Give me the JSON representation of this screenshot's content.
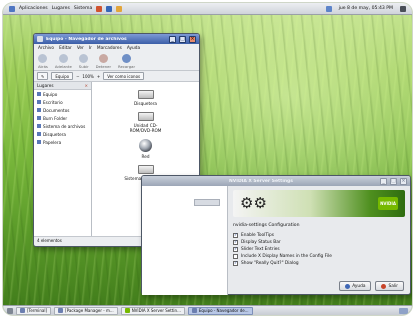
{
  "top_panel": {
    "menus": [
      "Aplicaciones",
      "Lugares",
      "Sistema"
    ],
    "clock": "jue 8 de may, 05:43 PM"
  },
  "file_manager": {
    "title": "Equipo - Navegador de archivos",
    "menu": [
      "Archivo",
      "Editar",
      "Ver",
      "Ir",
      "Marcadores",
      "Ayuda"
    ],
    "toolbar": [
      "Atrás",
      "Adelante",
      "Subir",
      "Detener",
      "Recargar"
    ],
    "location_button": "Equipo",
    "zoom": "100%",
    "view_mode": "Ver como iconos",
    "sidebar_title": "Lugares",
    "sidebar_items": [
      "Equipo",
      "Escritorio",
      "Documentos",
      "Burn Folder",
      "Sistema de archivos",
      "Disquetera",
      "Papelera"
    ],
    "devices": [
      {
        "label": "Disquetera"
      },
      {
        "label": "Unidad CD-ROM/DVD-ROM"
      },
      {
        "label": "Red"
      },
      {
        "label": "Sistema de archivos"
      }
    ],
    "status": "4 elementos"
  },
  "nvidia_window": {
    "title": "NVIDIA X Server Settings",
    "brand": "NVIDIA",
    "config_title": "nvidia-settings Configuration",
    "options": [
      {
        "label": "Enable ToolTips",
        "checked": true
      },
      {
        "label": "Display Status Bar",
        "checked": true
      },
      {
        "label": "Slider Text Entries",
        "checked": true
      },
      {
        "label": "Include X Display Names in the Config File",
        "checked": false
      },
      {
        "label": "Show \"Really Quit?\" Dialog",
        "checked": true
      }
    ],
    "help_button": "Ayuda",
    "quit_button": "Salir"
  },
  "taskbar": [
    {
      "label": "[Terminal]",
      "active": false
    },
    {
      "label": "[Package Manager - m...",
      "active": false
    },
    {
      "label": "NVIDIA X Server Settin...",
      "active": false
    },
    {
      "label": "Equipo - Navegador de...",
      "active": true
    }
  ],
  "colors": {
    "titlebar_active": "#3b5ea8",
    "selection": "#3f67b5",
    "nvidia_green": "#76b900"
  }
}
